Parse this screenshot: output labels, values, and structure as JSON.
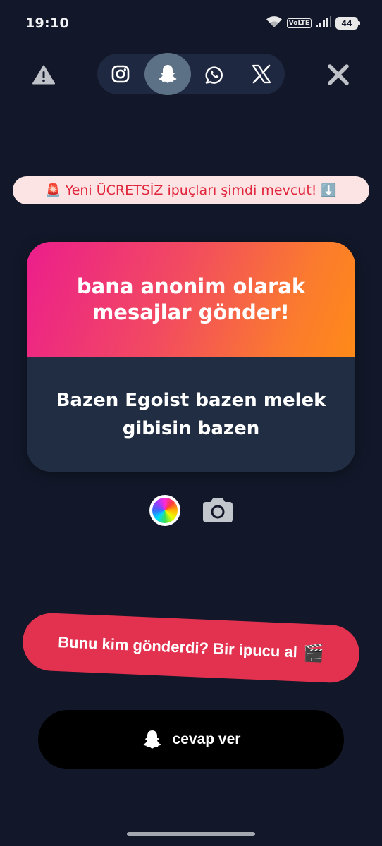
{
  "status_bar": {
    "time": "19:10",
    "network_badge": "VoLTE",
    "battery": "44"
  },
  "top_bar": {
    "icons": {
      "warning": "warning-icon",
      "close": "close-icon"
    },
    "platforms": [
      {
        "name": "instagram",
        "icon": "instagram-icon",
        "active": false
      },
      {
        "name": "snapchat",
        "icon": "snapchat-ghost-icon",
        "active": true
      },
      {
        "name": "whatsapp",
        "icon": "whatsapp-icon",
        "active": false
      },
      {
        "name": "x",
        "icon": "x-icon",
        "active": false
      }
    ]
  },
  "banner": {
    "leading_emoji": "🚨",
    "text": "Yeni ÜCRETSİZ ipuçları şimdi mevcut!",
    "trailing_emoji": "⬇️"
  },
  "card": {
    "title": "bana anonim olarak mesajlar gönder!",
    "message": "Bazen Egoist bazen melek gibisin bazen"
  },
  "tools": {
    "color_picker": "color-wheel-icon",
    "camera": "camera-icon"
  },
  "hint_button": {
    "label": "Bunu kim gönderdi? Bir ipucu al",
    "emoji": "🎬"
  },
  "reply_button": {
    "label": "cevap ver",
    "icon": "snapchat-ghost-icon"
  },
  "colors": {
    "background": "#121829",
    "card_body": "#212d42",
    "gradient_start": "#ec1e8c",
    "gradient_end": "#ff8a18",
    "hint_button": "#e2324f",
    "reply_button": "#000000",
    "banner_bg": "#fde4e4",
    "banner_text": "#e0263c"
  }
}
